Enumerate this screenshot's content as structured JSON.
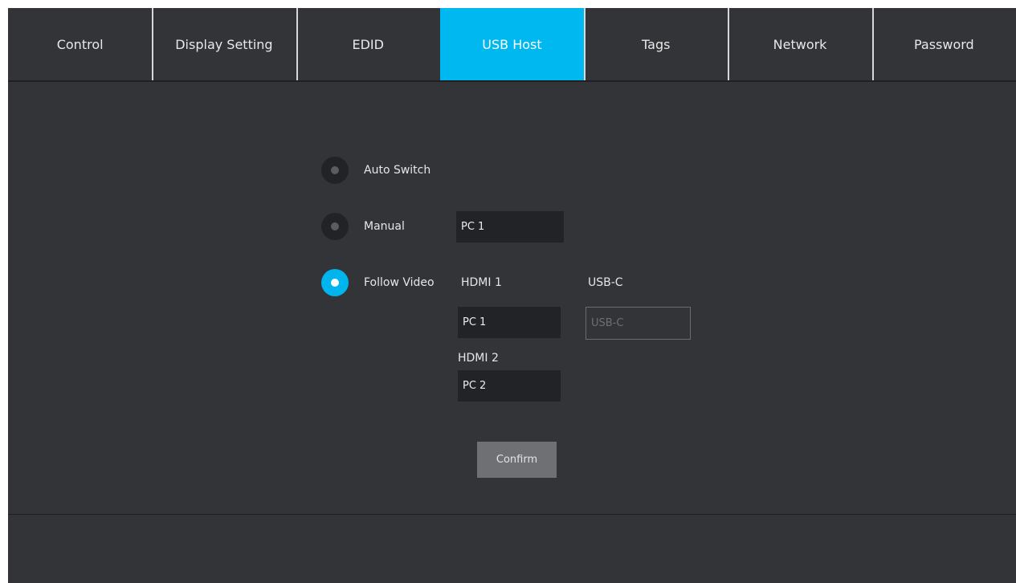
{
  "tabs": [
    {
      "label": "Control",
      "active": false
    },
    {
      "label": "Display Setting",
      "active": false
    },
    {
      "label": "EDID",
      "active": false
    },
    {
      "label": "USB Host",
      "active": true
    },
    {
      "label": "Tags",
      "active": false
    },
    {
      "label": "Network",
      "active": false
    },
    {
      "label": "Password",
      "active": false
    }
  ],
  "usb_host": {
    "modes": [
      {
        "label": "Auto Switch",
        "checked": false
      },
      {
        "label": "Manual",
        "checked": false
      },
      {
        "label": "Follow Video",
        "checked": true
      }
    ],
    "manual_value": "PC 1",
    "follow_video": {
      "hdmi1_label": "HDMI 1",
      "hdmi1_value": "PC 1",
      "hdmi2_label": "HDMI 2",
      "hdmi2_value": "PC 2",
      "usbc_label": "USB-C",
      "usbc_value": "USB-C"
    },
    "confirm_label": "Confirm"
  },
  "colors": {
    "accent": "#00b8f0",
    "background": "#333438",
    "field": "#222326"
  }
}
